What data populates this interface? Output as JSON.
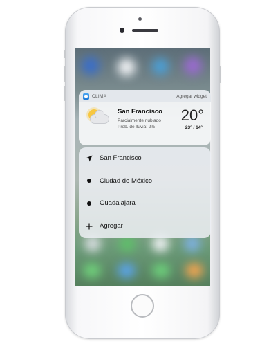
{
  "widget": {
    "app_name": "CLIMA",
    "add_widget_label": "Agregar widget",
    "city": "San Francisco",
    "condition": "Parcialmente nublado",
    "rain_probability": "Prob. de lluvia: 2%",
    "temperature": "20°",
    "temp_range": "23° / 14°",
    "icon": "partly-cloudy-icon"
  },
  "menu": {
    "items": [
      {
        "label": "San Francisco",
        "icon": "location-arrow-icon"
      },
      {
        "label": "Ciudad de México",
        "icon": "dot-icon"
      },
      {
        "label": "Guadalajara",
        "icon": "dot-icon"
      },
      {
        "label": "Agregar",
        "icon": "plus-icon"
      }
    ]
  }
}
